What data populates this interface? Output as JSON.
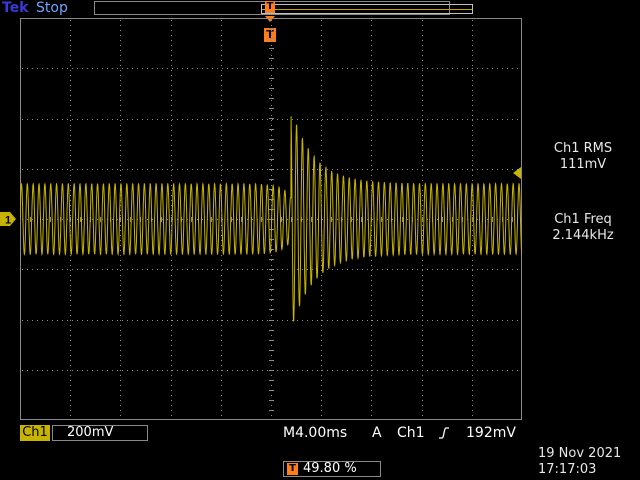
{
  "header": {
    "brand": "Tek",
    "run_state": "Stop",
    "trigger_marker": "T"
  },
  "measurements": [
    {
      "label": "Ch1 RMS",
      "value": "111mV"
    },
    {
      "label": "Ch1 Freq",
      "value": "2.144kHz"
    }
  ],
  "channel": {
    "name": "Ch1",
    "scale": "200mV",
    "marker": "1"
  },
  "timebase": {
    "value": "M4.00ms",
    "acquire": "A",
    "trigger_source": "Ch1",
    "trigger_level": "192mV"
  },
  "trigger_position": {
    "icon": "T",
    "value": "49.80 %"
  },
  "datetime": {
    "date": "19 Nov 2021",
    "time": "17:17:03"
  },
  "colors": {
    "trace": "#c8b400",
    "trigger": "#ff7d18",
    "grid": "#8a8a8a",
    "text": "#e8e8e8"
  },
  "waveform": {
    "baseline_amplitude_div": 0.7,
    "burst_peak_div": 2.2,
    "burst_center_div": 5.4,
    "frequency_khz": 2.144
  }
}
